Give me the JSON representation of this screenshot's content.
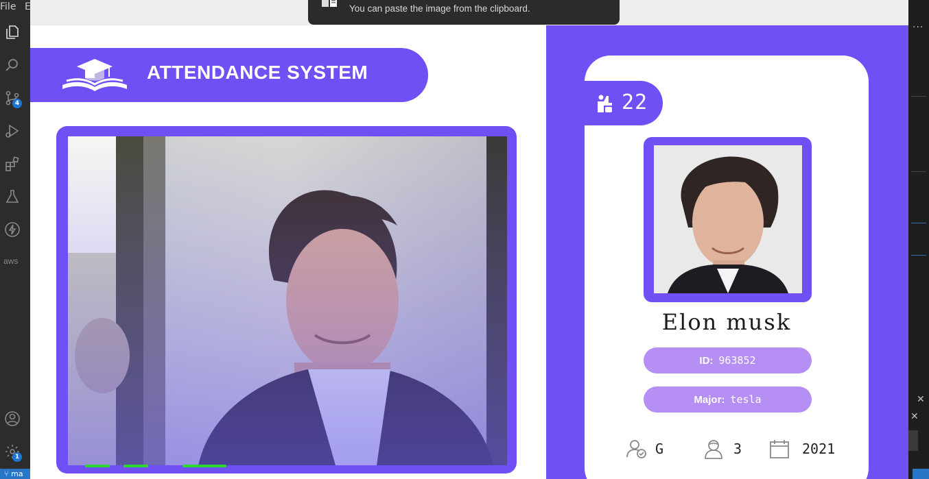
{
  "vscode": {
    "menu_file": "File",
    "menu_edit_fragment": "E",
    "source_control_badge": "4",
    "settings_badge": "1",
    "aws_label": "aws",
    "branch": "ma",
    "more_actions": "···",
    "close_glyph": "✕"
  },
  "toast": {
    "message": "You can paste the image from the clipboard."
  },
  "header": {
    "title": "ATTENDANCE SYSTEM"
  },
  "student": {
    "total_attendance": "22",
    "name": "Elon musk",
    "id_label": "ID:",
    "id_value": "963852",
    "major_label": "Major:",
    "major_value": "tesla",
    "standing": "G",
    "year": "3",
    "starting_year": "2021"
  },
  "colors": {
    "brand_purple": "#7050f5",
    "pill_lavender": "#b58ff3"
  }
}
